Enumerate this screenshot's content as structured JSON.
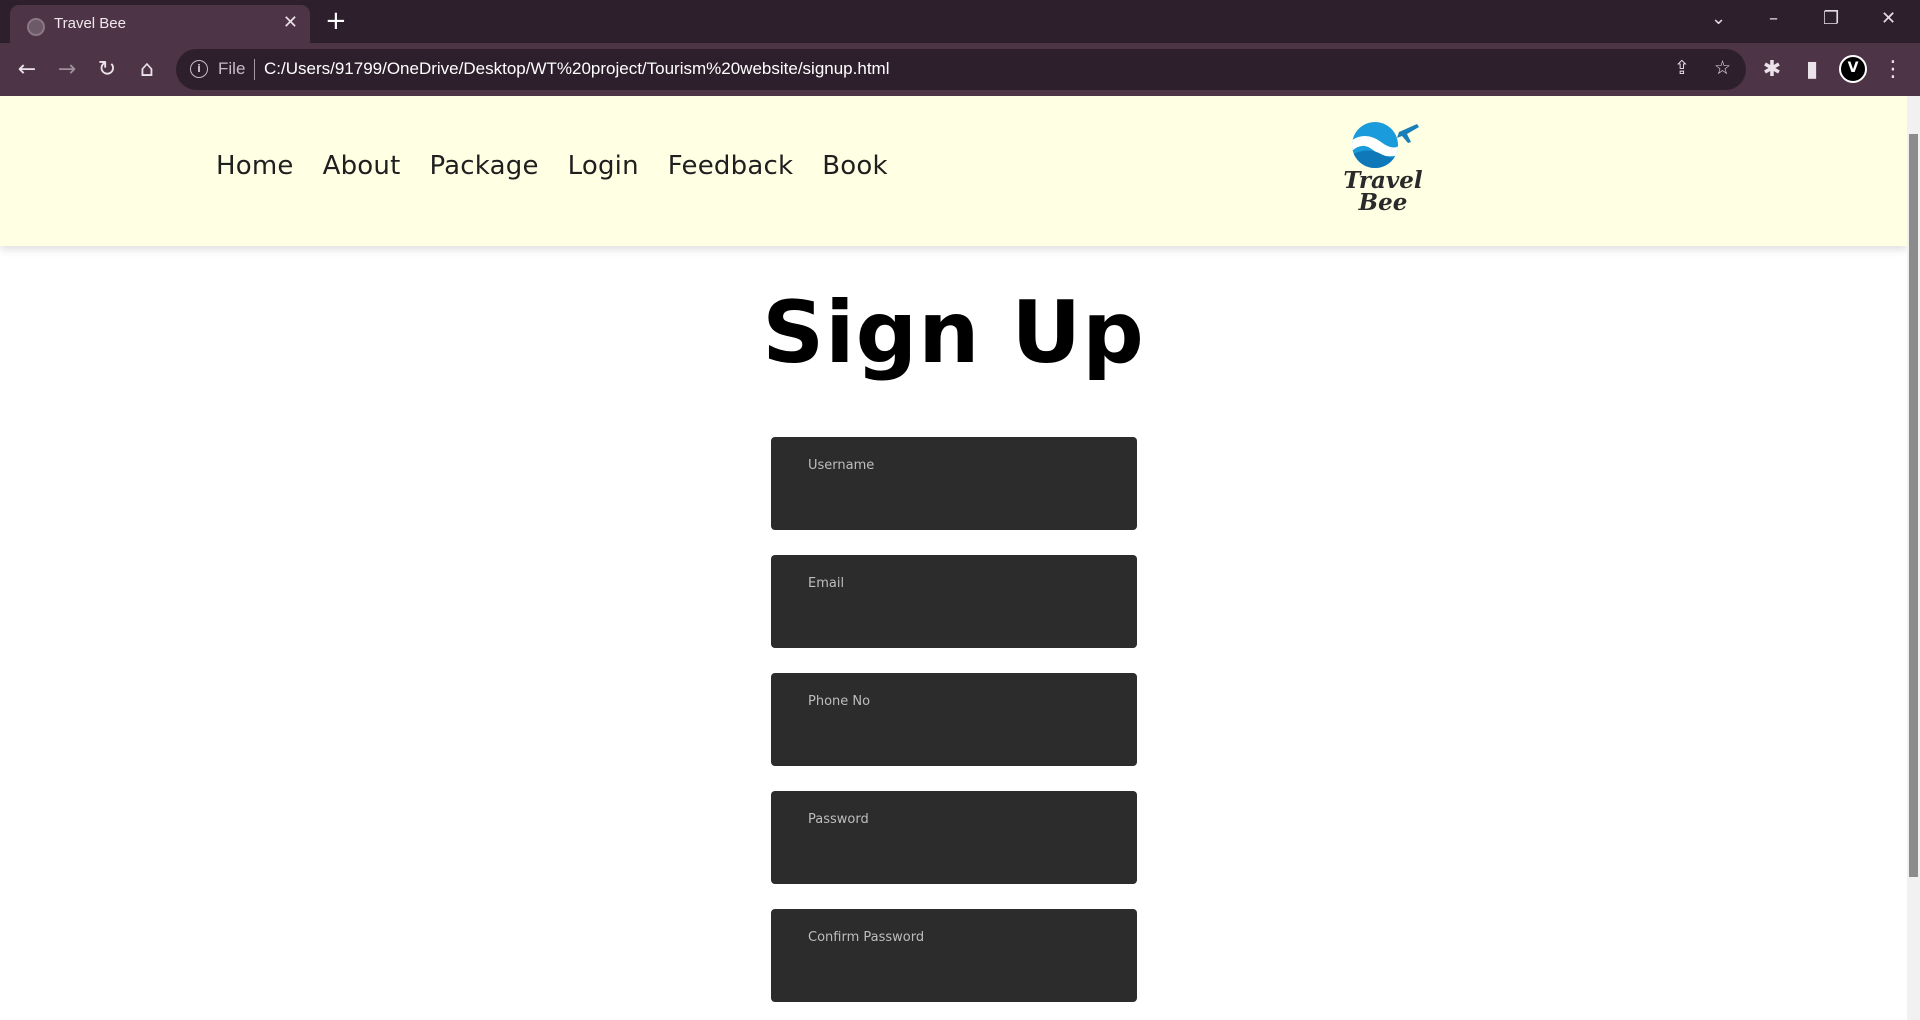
{
  "browser": {
    "tab_title": "Travel Bee",
    "tab_close": "✕",
    "new_tab": "+",
    "omnibox_prefix": "File",
    "url": "C:/Users/91799/OneDrive/Desktop/WT%20project/Tourism%20website/signup.html",
    "window_controls": {
      "menu": "⌄",
      "minimize": "–",
      "restore": "❐",
      "close": "✕"
    },
    "toolbar_icons": {
      "back": "←",
      "forward": "→",
      "reload": "↻",
      "home": "⌂",
      "share": "⇪",
      "bookmark": "☆",
      "extensions": "✱",
      "sidepanel": "▮",
      "menu": "⋮"
    }
  },
  "site": {
    "nav": [
      "Home",
      "About",
      "Package",
      "Login",
      "Feedback",
      "Book"
    ],
    "logo_text": {
      "line1": "Travel",
      "line2": "Bee"
    },
    "brand_colors": {
      "header_bg": "#ffffe4",
      "logo_blue": "#1a9bdc",
      "field_bg": "#2c2c2c"
    }
  },
  "signup": {
    "title": "Sign Up",
    "fields": [
      {
        "placeholder": "Username",
        "value": ""
      },
      {
        "placeholder": "Email",
        "value": ""
      },
      {
        "placeholder": "Phone No",
        "value": ""
      },
      {
        "placeholder": "Password",
        "value": ""
      },
      {
        "placeholder": "Confirm Password",
        "value": ""
      }
    ]
  }
}
